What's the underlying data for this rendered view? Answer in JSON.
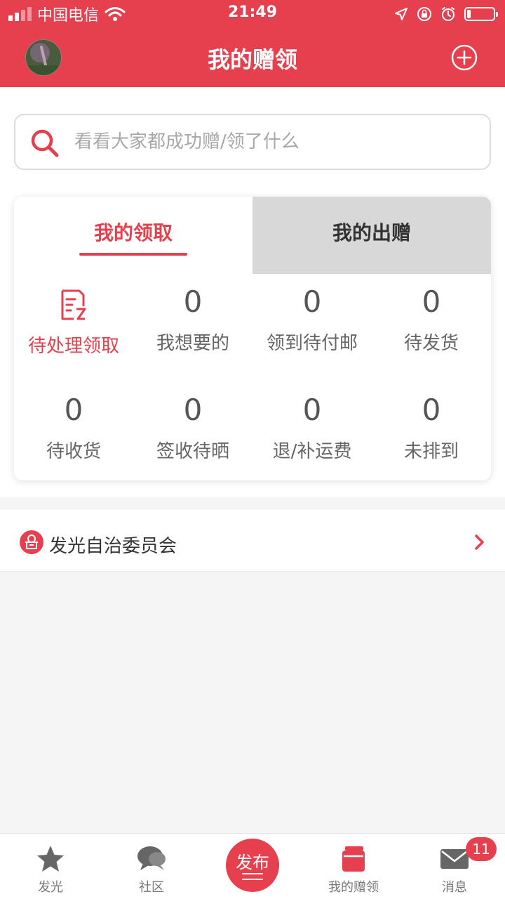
{
  "status_bar": {
    "carrier": "中国电信",
    "time": "21:49",
    "battery_level": 0.15
  },
  "header": {
    "title": "我的赠领"
  },
  "search": {
    "placeholder": "看看大家都成功赠/领了什么"
  },
  "tabs": [
    {
      "label": "我的领取",
      "active": true
    },
    {
      "label": "我的出赠",
      "active": false
    }
  ],
  "stats": {
    "pending_label": "待处理领取",
    "items": [
      {
        "value": "0",
        "label": "我想要的"
      },
      {
        "value": "0",
        "label": "领到待付邮"
      },
      {
        "value": "0",
        "label": "待发货"
      },
      {
        "value": "0",
        "label": "待收货"
      },
      {
        "value": "0",
        "label": "签收待晒"
      },
      {
        "value": "0",
        "label": "退/补运费"
      },
      {
        "value": "0",
        "label": "未排到"
      }
    ]
  },
  "committee": {
    "label": "发光自治委员会"
  },
  "tabbar": {
    "items": [
      {
        "label": "发光",
        "icon": "star-icon"
      },
      {
        "label": "社区",
        "icon": "chat-bubble-icon"
      },
      {
        "label": "发布",
        "icon": "publish-button"
      },
      {
        "label": "我的赠领",
        "icon": "gift-box-icon"
      },
      {
        "label": "消息",
        "icon": "mail-icon"
      }
    ],
    "message_badge": "11"
  },
  "colors": {
    "accent": "#e6404f",
    "inactive_tab": "#d8d8d8",
    "background": "#f5f5f5"
  }
}
